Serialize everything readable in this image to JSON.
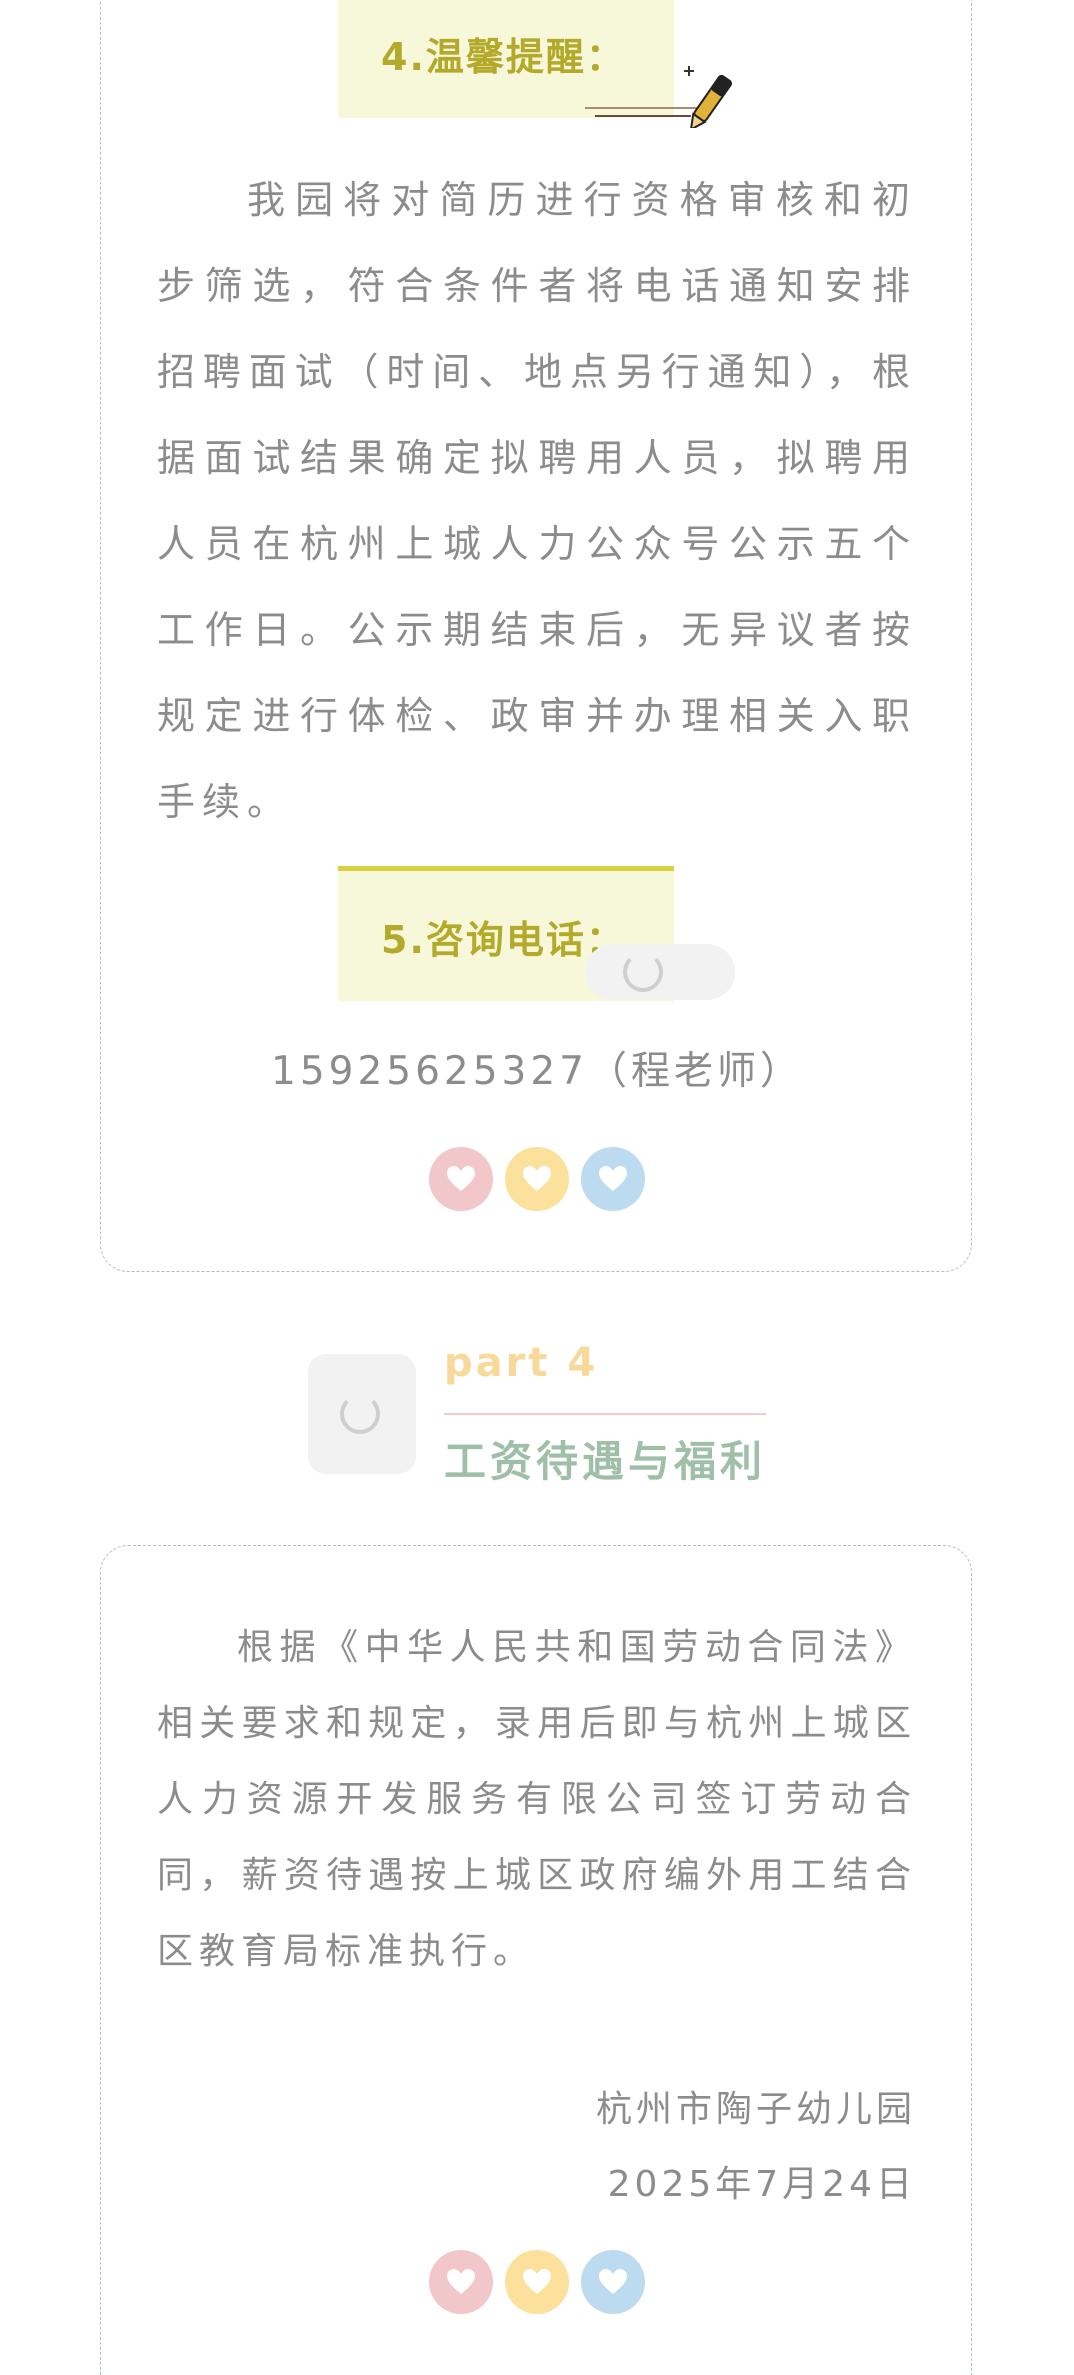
{
  "section4": {
    "heading": "4.温馨提醒：",
    "text": "我园将对简历进行资格审核和初步筛选，符合条件者将电话通知安排招聘面试（时间、地点另行通知），根据面试结果确定拟聘用人员，拟聘用人员在杭州上城人力公众号公示五个工作日。公示期结束后，无异议者按规定进行体检、政审并办理相关入职手续。"
  },
  "section5": {
    "heading": "5.咨询电话：",
    "phone": "15925625327（程老师）"
  },
  "part4": {
    "label": "part 4",
    "title": "工资待遇与福利",
    "text": "根据《中华人民共和国劳动合同法》相关要求和规定，录用后即与杭州上城区人力资源开发服务有限公司签订劳动合同，薪资待遇按上城区政府编外用工结合区教育局标准执行。",
    "signature_org": "杭州市陶子幼儿园",
    "signature_date": "2025年7月24日"
  },
  "colors": {
    "heading_text": "#b3a92a",
    "heading_bg": "#f7f7d9",
    "body_text": "#8c8c8c",
    "part_label": "#f8d99a",
    "part_title": "#9fbfa8",
    "heart_pink": "#f2c7c9",
    "heart_yellow": "#fbe19b",
    "heart_blue": "#bcdbf0"
  },
  "icons": [
    "pen-icon",
    "loading-spinner-icon",
    "heart-icon"
  ]
}
